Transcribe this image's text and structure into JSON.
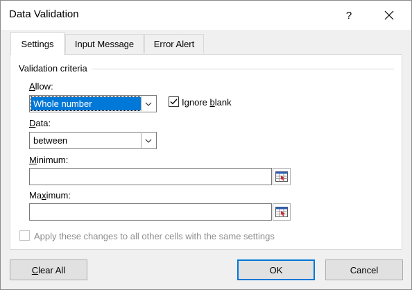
{
  "window": {
    "title": "Data Validation",
    "help_label": "?"
  },
  "tabs": [
    {
      "label": "Settings",
      "active": true
    },
    {
      "label": "Input Message",
      "active": false
    },
    {
      "label": "Error Alert",
      "active": false
    }
  ],
  "criteria": {
    "group_label": "Validation criteria",
    "allow_label_prefix": "",
    "allow_label_mnemonic": "A",
    "allow_label_rest": "llow:",
    "allow_value": "Whole number",
    "ignore_blank_prefix": "Ignore ",
    "ignore_blank_mnemonic": "b",
    "ignore_blank_rest": "lank",
    "ignore_blank_checked": true,
    "data_label_prefix": "",
    "data_label_mnemonic": "D",
    "data_label_rest": "ata:",
    "data_value": "between",
    "minimum_label_prefix": "",
    "minimum_label_mnemonic": "M",
    "minimum_label_rest": "inimum:",
    "minimum_value": "",
    "maximum_label_prefix": "Ma",
    "maximum_label_mnemonic": "x",
    "maximum_label_rest": "imum:",
    "maximum_value": "",
    "apply_all_label": "Apply these changes to all other cells with the same settings",
    "apply_all_checked": false,
    "apply_all_enabled": false
  },
  "buttons": {
    "clear_all_mnemonic": "C",
    "clear_all_rest": "lear All",
    "ok_label": "OK",
    "cancel_label": "Cancel"
  },
  "icons": {
    "close": "close-icon",
    "dropdown": "chevron-down-icon",
    "checkmark": "checkmark-icon",
    "range_select": "range-selector-icon"
  },
  "colors": {
    "selection": "#0078d7",
    "dialog_bg": "#f0f0f0",
    "panel_bg": "#ffffff"
  }
}
